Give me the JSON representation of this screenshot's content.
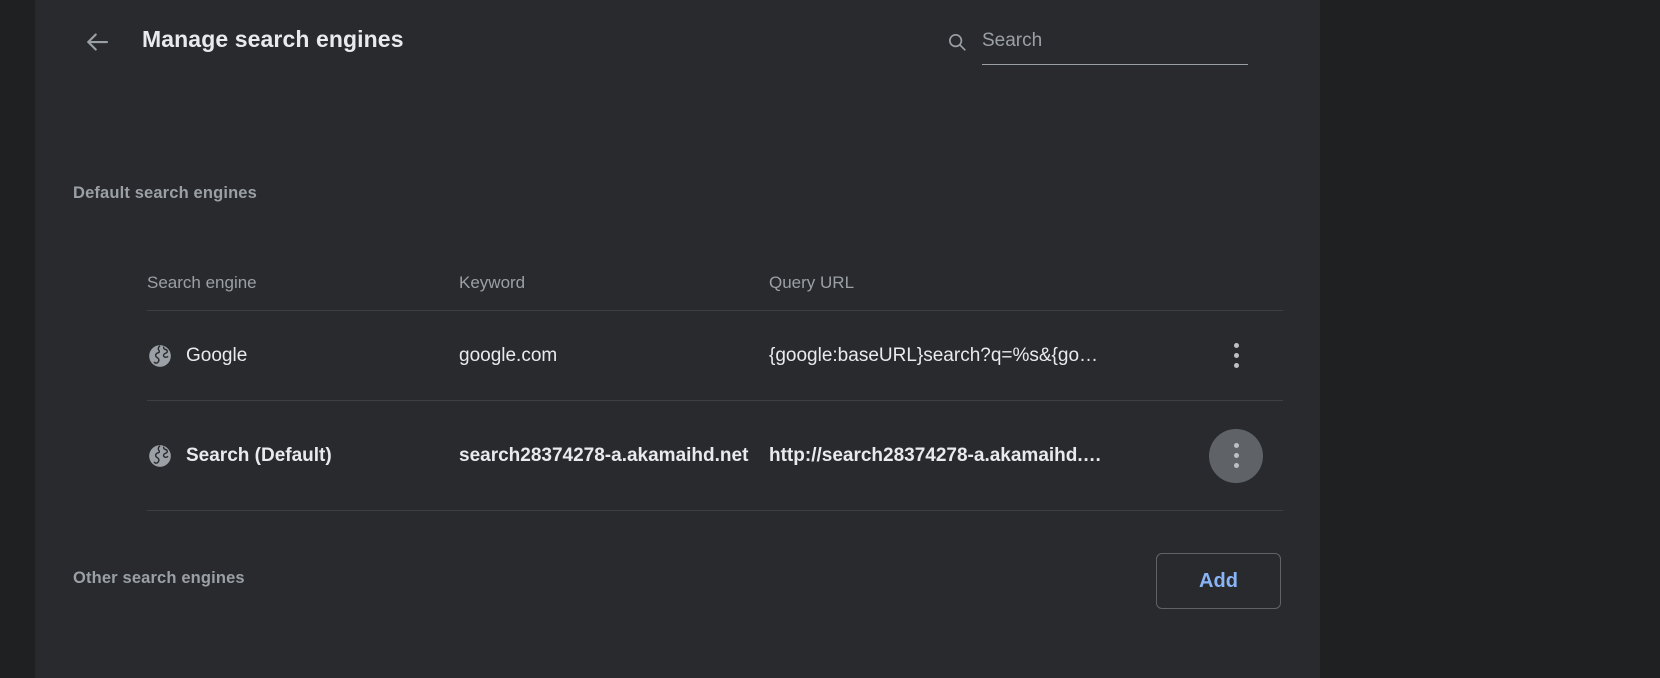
{
  "window": {
    "background_color": "#202124",
    "panel_color": "#292a2d"
  },
  "header": {
    "back_label": "Back",
    "title": "Manage search engines",
    "search": {
      "placeholder": "Search",
      "value": ""
    }
  },
  "sections": {
    "default": {
      "label": "Default search engines",
      "columns": {
        "engine": "Search engine",
        "keyword": "Keyword",
        "url": "Query URL"
      },
      "rows": [
        {
          "engine": "Google",
          "keyword": "google.com",
          "url": "{google:baseURL}search?q=%s&{go…",
          "is_default": false,
          "menu_active": false
        },
        {
          "engine": "Search (Default)",
          "keyword": "search28374278-a.akamaihd.net",
          "url": "http://search28374278-a.akamaihd.…",
          "is_default": true,
          "menu_active": true
        }
      ]
    },
    "other": {
      "label": "Other search engines",
      "add_label": "Add"
    }
  },
  "colors": {
    "accent": "#8ab4f8",
    "text_primary": "#e8eaed",
    "text_secondary": "#9aa0a6",
    "divider": "#3c4043",
    "menu_active_bg": "#5f6368"
  }
}
